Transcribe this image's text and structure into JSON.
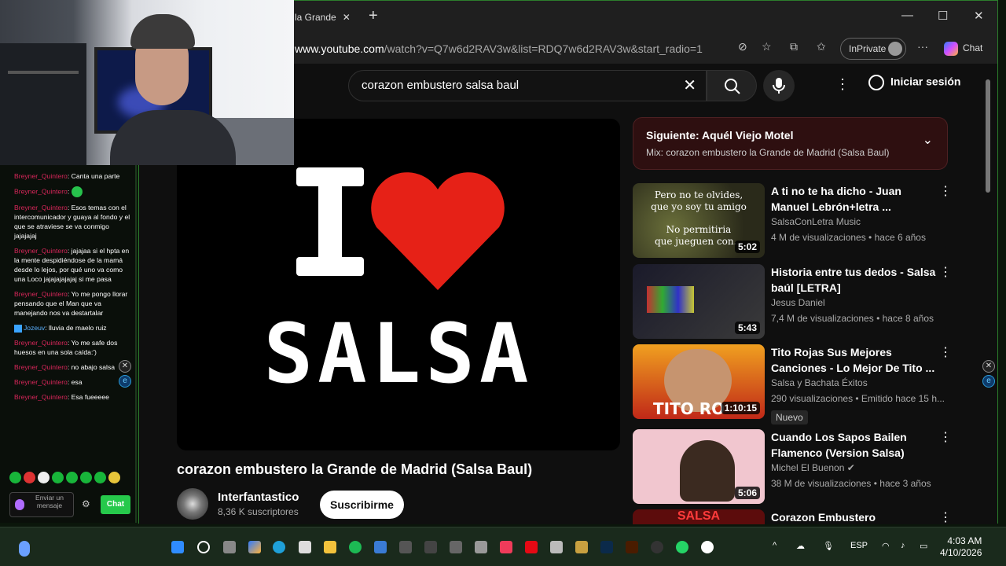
{
  "browser": {
    "tab_title": "la Grande",
    "url_domain": "www.youtube.com",
    "url_path": "/watch?v=Q7w6d2RAV3w&list=RDQ7w6d2RAV3w&start_radio=1",
    "inprivate_label": "InPrivate",
    "copilot_label": "Chat"
  },
  "youtube": {
    "search_query": "corazon embustero salsa baul",
    "signin_label": "Iniciar sesión",
    "video_graphic": {
      "letter": "I",
      "word": "SALSA"
    },
    "video_title": "corazon embustero la Grande de Madrid (Salsa Baul)",
    "channel_name": "Interfantastico",
    "channel_subs": "8,36 K suscriptores",
    "subscribe_label": "Suscribirme",
    "next_up": {
      "title": "Siguiente: Aquél Viejo Motel",
      "subtitle": "Mix: corazon embustero la Grande de Madrid (Salsa Baul)"
    },
    "recommendations": [
      {
        "title": "A ti no te ha dicho - Juan Manuel Lebrón+letra ...",
        "channel": "SalsaConLetra Music",
        "meta": "4 M de visualizaciones • hace 6 años",
        "duration": "5:02",
        "thumb_text": [
          "Pero no te olvides,",
          "que yo soy tu amigo",
          "No permitiria",
          "que jueguen con..."
        ]
      },
      {
        "title": "Historia entre tus dedos - Salsa baúl [LETRA]",
        "channel": "Jesus Daniel",
        "meta": "7,4 M de visualizaciones • hace 8 años",
        "duration": "5:43"
      },
      {
        "title": "Tito Rojas Sus Mejores Canciones - Lo Mejor De Tito ...",
        "channel": "Salsa y Bachata Éxitos",
        "meta": "290 visualizaciones • Emitido hace 15 h...",
        "duration": "1:10:15",
        "badge": "Nuevo",
        "thumb_text": [
          "TITO RO"
        ]
      },
      {
        "title": "Cuando Los Sapos Bailen Flamenco (Version Salsa)",
        "channel": "Michel El Buenon",
        "meta": "38 M de visualizaciones • hace 3 años",
        "duration": "5:06"
      },
      {
        "title": "Corazon Embustero",
        "thumb_text": [
          "SALSA"
        ]
      }
    ]
  },
  "chat": {
    "messages": [
      {
        "user": "Breyner_Quintero",
        "text": ": Canta una parte"
      },
      {
        "user": "Breyner_Quintero",
        "text": ": "
      },
      {
        "user": "Breyner_Quintero",
        "text": ": Esos temas con el intercomunicador y guaya al fondo y el que se atraviese se va conmigo jajajajaj"
      },
      {
        "user": "Breyner_Quintero",
        "text": ": jajajaa si el hpta en la mente despidiéndose de la mamá desde lo lejos, por qué uno va como una Loco jajajajajajaj si me pasa"
      },
      {
        "user": "Breyner_Quintero",
        "text": ": Yo me pongo llorar pensando que el Man que va manejando nos va destartalar"
      },
      {
        "user": "Jozeuv",
        "text": ": lluvia de maelo ruiz"
      },
      {
        "user": "Breyner_Quintero",
        "text": ": Yo me safe dos huesos en una sola caída:')"
      },
      {
        "user": "Breyner_Quintero",
        "text": ": no abajo salsa"
      },
      {
        "user": "Breyner_Quintero",
        "text": ": esa"
      },
      {
        "user": "Breyner_Quintero",
        "text": ": Esa fueeeee"
      }
    ],
    "input_placeholder": "Enviar un mensaje",
    "send_label": "Chat"
  },
  "taskbar": {
    "lang": "ESP",
    "time": "4:03 AM",
    "date": "4/10/2026"
  },
  "colors": {
    "accent_green": "#26c94b",
    "next_bg": "#2e0f10",
    "heart": "#e62117"
  }
}
